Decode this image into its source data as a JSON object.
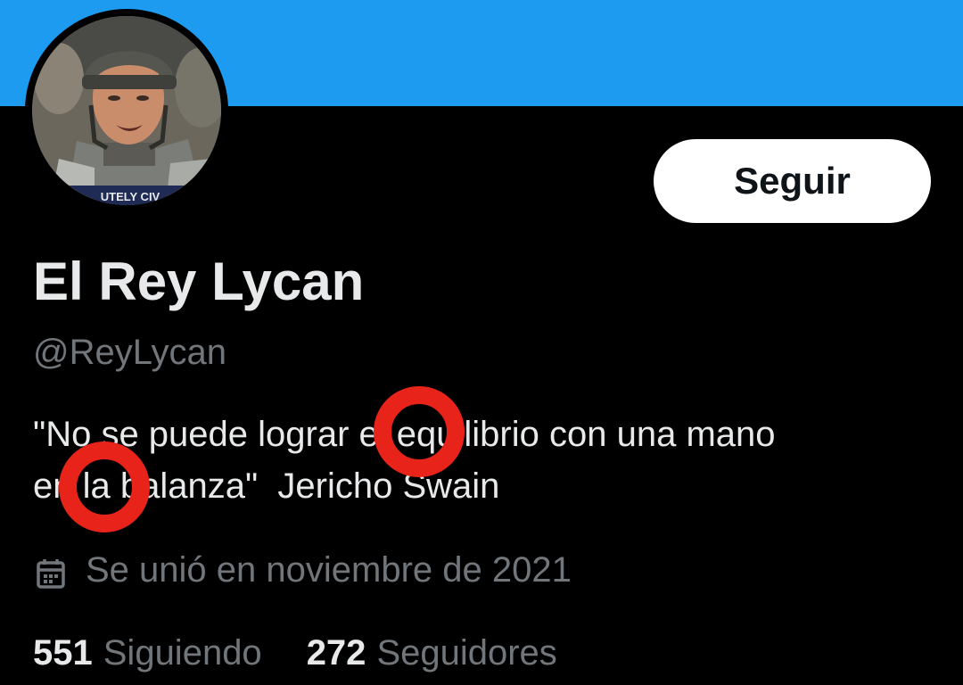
{
  "profile": {
    "display_name": "El Rey Lycan",
    "handle": "@ReyLycan",
    "bio_lines": [
      "\"No se puede lograr el equilibrio con una mano",
      "en la balanza\"  Jericho Swain"
    ],
    "joined": "Se unió en noviembre de 2021",
    "avatar_caption": "UTELY CIV"
  },
  "actions": {
    "follow_label": "Seguir"
  },
  "stats": {
    "following_count": "551",
    "following_label": "Siguiendo",
    "followers_count": "272",
    "followers_label": "Seguidores"
  },
  "icons": {
    "calendar": "calendar-icon"
  },
  "colors": {
    "banner": "#1d9bf0",
    "background": "#000000",
    "primary_text": "#e7e9ea",
    "secondary_text": "#71767b",
    "annotation_marker": "#e8231a"
  }
}
